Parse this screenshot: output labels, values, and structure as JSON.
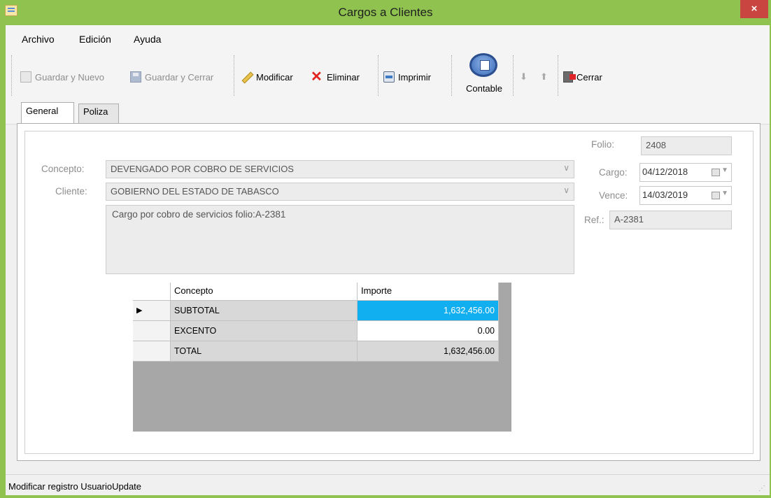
{
  "window": {
    "title": "Cargos a Clientes",
    "close_glyph": "×"
  },
  "menu": [
    "Archivo",
    "Edición",
    "Ayuda"
  ],
  "toolbar": {
    "guardar_nuevo": "Guardar y Nuevo",
    "guardar_cerrar": "Guardar y Cerrar",
    "modificar": "Modificar",
    "eliminar": "Eliminar",
    "imprimir": "Imprimir",
    "contable": "Contable",
    "cerrar": "Cerrar"
  },
  "tabs": [
    "General",
    "Poliza"
  ],
  "form": {
    "folio_label": "Folio:",
    "folio_value": "2408",
    "concepto_label": "Concepto:",
    "concepto_value": "DEVENGADO POR COBRO DE SERVICIOS",
    "cliente_label": "Cliente:",
    "cliente_value": "GOBIERNO DEL ESTADO DE TABASCO",
    "cargo_label": "Cargo:",
    "cargo_value": "04/12/2018",
    "vence_label": "Vence:",
    "vence_value": "14/03/2019",
    "ref_label": "Ref.:",
    "ref_value": "A-2381",
    "notes": "Cargo por cobro de servicios folio:A-2381"
  },
  "grid": {
    "columns": [
      "Concepto",
      "Importe"
    ],
    "rows": [
      {
        "concepto": "SUBTOTAL",
        "importe": "1,632,456.00"
      },
      {
        "concepto": "EXCENTO",
        "importe": "0.00"
      },
      {
        "concepto": "TOTAL",
        "importe": "1,632,456.00"
      }
    ],
    "current_row_marker": "▶"
  },
  "status": {
    "text": "Modificar registro  UsuarioUpdate"
  },
  "colors": {
    "title_bar": "#8fc24f",
    "close_button": "#c94640",
    "selected_cell": "#11aef0"
  }
}
